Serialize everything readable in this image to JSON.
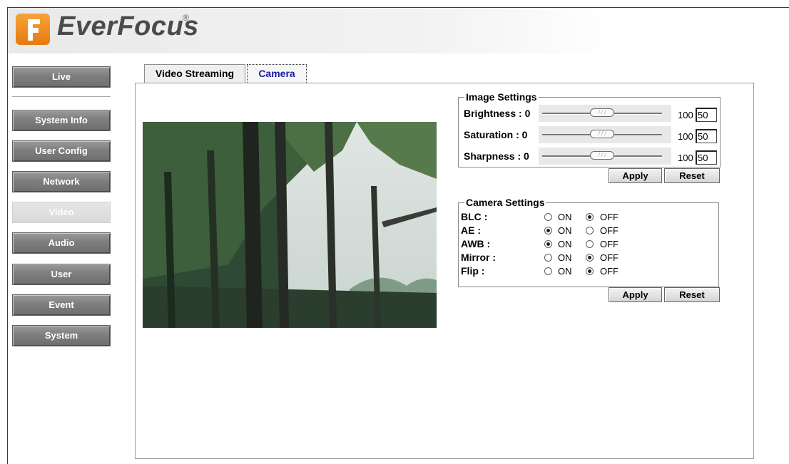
{
  "brand": {
    "name": "EverFocus",
    "registered": "®"
  },
  "nav": {
    "items": [
      {
        "label": "Live"
      },
      {
        "label": "System Info"
      },
      {
        "label": "User Config"
      },
      {
        "label": "Network"
      },
      {
        "label": "Video",
        "active": true
      },
      {
        "label": "Audio"
      },
      {
        "label": "User"
      },
      {
        "label": "Event"
      },
      {
        "label": "System"
      }
    ]
  },
  "tabs": [
    {
      "label": "Video Streaming"
    },
    {
      "label": "Camera",
      "active": true
    }
  ],
  "image_settings": {
    "title": "Image Settings",
    "rows": [
      {
        "label": "Brightness : 0",
        "max": "100",
        "value": "50",
        "level_percent": 50
      },
      {
        "label": "Saturation : 0",
        "max": "100",
        "value": "50",
        "level_percent": 50
      },
      {
        "label": "Sharpness : 0",
        "max": "100",
        "value": "50",
        "level_percent": 50
      }
    ],
    "apply_label": "Apply",
    "reset_label": "Reset"
  },
  "camera_settings": {
    "title": "Camera Settings",
    "on_label": "ON",
    "off_label": "OFF",
    "rows": [
      {
        "label": "BLC :",
        "selected": "OFF"
      },
      {
        "label": "AE :",
        "selected": "ON"
      },
      {
        "label": "AWB :",
        "selected": "ON"
      },
      {
        "label": "Mirror :",
        "selected": "OFF"
      },
      {
        "label": "Flip :",
        "selected": "OFF"
      }
    ],
    "apply_label": "Apply",
    "reset_label": "Reset"
  },
  "colors": {
    "brand_orange": "#f08a1c",
    "nav_gray": "#7e7e7e",
    "tab_active_text": "#1a1aa6"
  }
}
